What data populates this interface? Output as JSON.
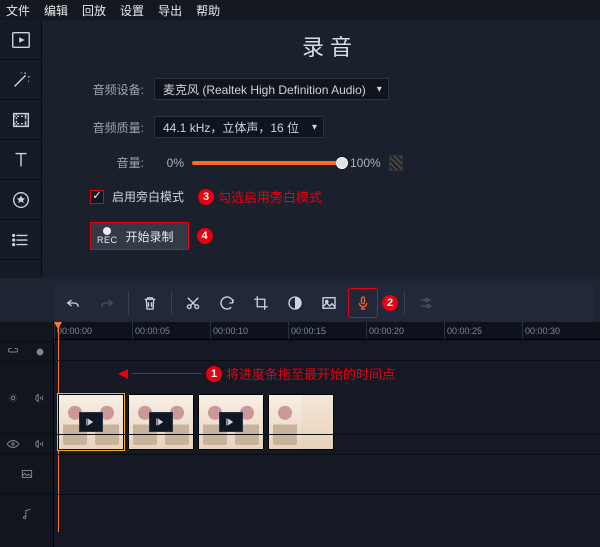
{
  "menu": {
    "items": [
      "文件",
      "编辑",
      "回放",
      "设置",
      "导出",
      "帮助"
    ]
  },
  "sidebar": {
    "items": [
      {
        "name": "media-icon"
      },
      {
        "name": "wand-icon"
      },
      {
        "name": "frame-icon"
      },
      {
        "name": "text-icon"
      },
      {
        "name": "sticker-icon"
      },
      {
        "name": "list-icon"
      }
    ]
  },
  "panel": {
    "title": "录音",
    "device_label": "音频设备:",
    "device_value": "麦克风 (Realtek High Definition Audio)",
    "quality_label": "音频质量:",
    "quality_value": "44.1 kHz，立体声，16 位",
    "volume_label": "音量:",
    "volume_min": "0%",
    "volume_max": "100%",
    "narration_label": "启用旁白模式",
    "rec_icon_text": "REC",
    "rec_label": "开始录制"
  },
  "annotations": {
    "a1": "将进度条拖至最开始的时间点",
    "a3": "勾选启用旁白模式",
    "badge1": "1",
    "badge2": "2",
    "badge3": "3",
    "badge4": "4"
  },
  "toolbar": {
    "undo": "undo-icon",
    "redo": "redo-icon",
    "delete": "trash-icon",
    "cut": "scissors-icon",
    "rotate": "rotate-icon",
    "crop": "crop-icon",
    "color": "contrast-icon",
    "image": "image-icon",
    "mic": "microphone-icon",
    "props": "sliders-icon"
  },
  "timeline": {
    "ticks": [
      "00:00:00",
      "00:00:05",
      "00:00:10",
      "00:00:15",
      "00:00:20",
      "00:00:25",
      "00:00:30"
    ]
  }
}
